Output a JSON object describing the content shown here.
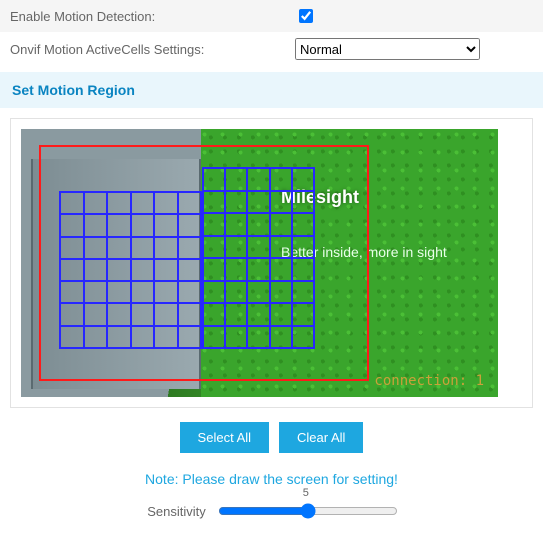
{
  "settings": {
    "enable_motion": {
      "label": "Enable Motion Detection:",
      "checked": true
    },
    "active_cells": {
      "label": "Onvif Motion ActiveCells Settings:",
      "selected": "Normal"
    }
  },
  "section_header": "Set Motion Region",
  "scene": {
    "logo": "Milesight",
    "slogan": "Better inside, more in sight",
    "connection_text": "connection: 1"
  },
  "buttons": {
    "select_all": "Select All",
    "clear_all": "Clear All"
  },
  "note": "Note: Please draw the screen for setting!",
  "sensitivity": {
    "label": "Sensitivity",
    "value": "5"
  }
}
